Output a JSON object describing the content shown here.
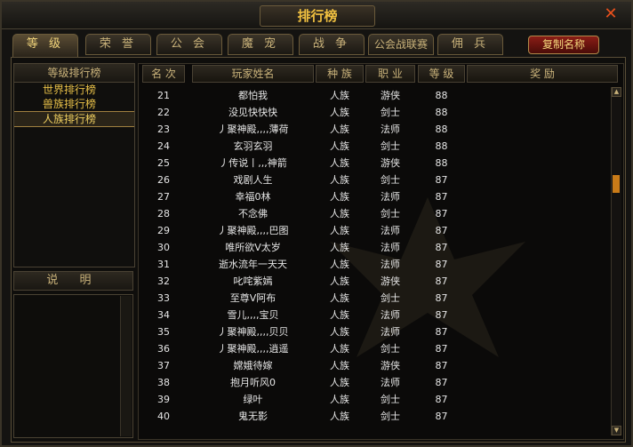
{
  "window": {
    "title": "排行榜",
    "close_icon": "close-icon"
  },
  "tabs": [
    {
      "label": "等 级",
      "active": true
    },
    {
      "label": "荣 誉",
      "active": false
    },
    {
      "label": "公 会",
      "active": false
    },
    {
      "label": "魔 宠",
      "active": false
    },
    {
      "label": "战 争",
      "active": false
    },
    {
      "label": "公会战联赛",
      "active": false
    },
    {
      "label": "佣 兵",
      "active": false
    }
  ],
  "copy_button": "复制名称",
  "left": {
    "header": "等级排行榜",
    "items": [
      {
        "label": "世界排行榜",
        "active": false
      },
      {
        "label": "兽族排行榜",
        "active": false
      },
      {
        "label": "人族排行榜",
        "active": true
      }
    ],
    "desc_header": "说 明"
  },
  "table": {
    "headers": [
      "名 次",
      "玩家姓名",
      "种 族",
      "职 业",
      "等 级",
      "奖 励"
    ],
    "rows": [
      {
        "rank": "21",
        "name": "都怕我",
        "race": "人族",
        "job": "游侠",
        "level": "88"
      },
      {
        "rank": "22",
        "name": "没见快快快",
        "race": "人族",
        "job": "剑士",
        "level": "88"
      },
      {
        "rank": "23",
        "name": "丿聚神殿,,,,薄荷",
        "race": "人族",
        "job": "法师",
        "level": "88"
      },
      {
        "rank": "24",
        "name": "玄羽玄羽",
        "race": "人族",
        "job": "剑士",
        "level": "88"
      },
      {
        "rank": "25",
        "name": "丿传说丨,,,神箭",
        "race": "人族",
        "job": "游侠",
        "level": "88"
      },
      {
        "rank": "26",
        "name": "戏剧人生",
        "race": "人族",
        "job": "剑士",
        "level": "87"
      },
      {
        "rank": "27",
        "name": "幸福0林",
        "race": "人族",
        "job": "法师",
        "level": "87"
      },
      {
        "rank": "28",
        "name": "不念佛",
        "race": "人族",
        "job": "剑士",
        "level": "87"
      },
      {
        "rank": "29",
        "name": "丿聚神殿,,,,巴图",
        "race": "人族",
        "job": "法师",
        "level": "87"
      },
      {
        "rank": "30",
        "name": "唯所欲V太岁",
        "race": "人族",
        "job": "法师",
        "level": "87"
      },
      {
        "rank": "31",
        "name": "逝水流年一天天",
        "race": "人族",
        "job": "法师",
        "level": "87"
      },
      {
        "rank": "32",
        "name": "叱咤紫嫣",
        "race": "人族",
        "job": "游侠",
        "level": "87"
      },
      {
        "rank": "33",
        "name": "至尊V阿布",
        "race": "人族",
        "job": "剑士",
        "level": "87"
      },
      {
        "rank": "34",
        "name": "雪儿,,,,宝贝",
        "race": "人族",
        "job": "法师",
        "level": "87"
      },
      {
        "rank": "35",
        "name": "丿聚神殿,,,,贝贝",
        "race": "人族",
        "job": "法师",
        "level": "87"
      },
      {
        "rank": "36",
        "name": "丿聚神殿,,,,逍遥",
        "race": "人族",
        "job": "剑士",
        "level": "87"
      },
      {
        "rank": "37",
        "name": "嫦娥待嫁",
        "race": "人族",
        "job": "游侠",
        "level": "87"
      },
      {
        "rank": "38",
        "name": "抱月听风0",
        "race": "人族",
        "job": "法师",
        "level": "87"
      },
      {
        "rank": "39",
        "name": "绿叶",
        "race": "人族",
        "job": "剑士",
        "level": "87"
      },
      {
        "rank": "40",
        "name": "鬼无影",
        "race": "人族",
        "job": "剑士",
        "level": "87"
      }
    ],
    "scroll_position": 0.25
  },
  "colors": {
    "accent": "#f0c040",
    "close": "#e8501c",
    "thumb": "#c97b18"
  }
}
